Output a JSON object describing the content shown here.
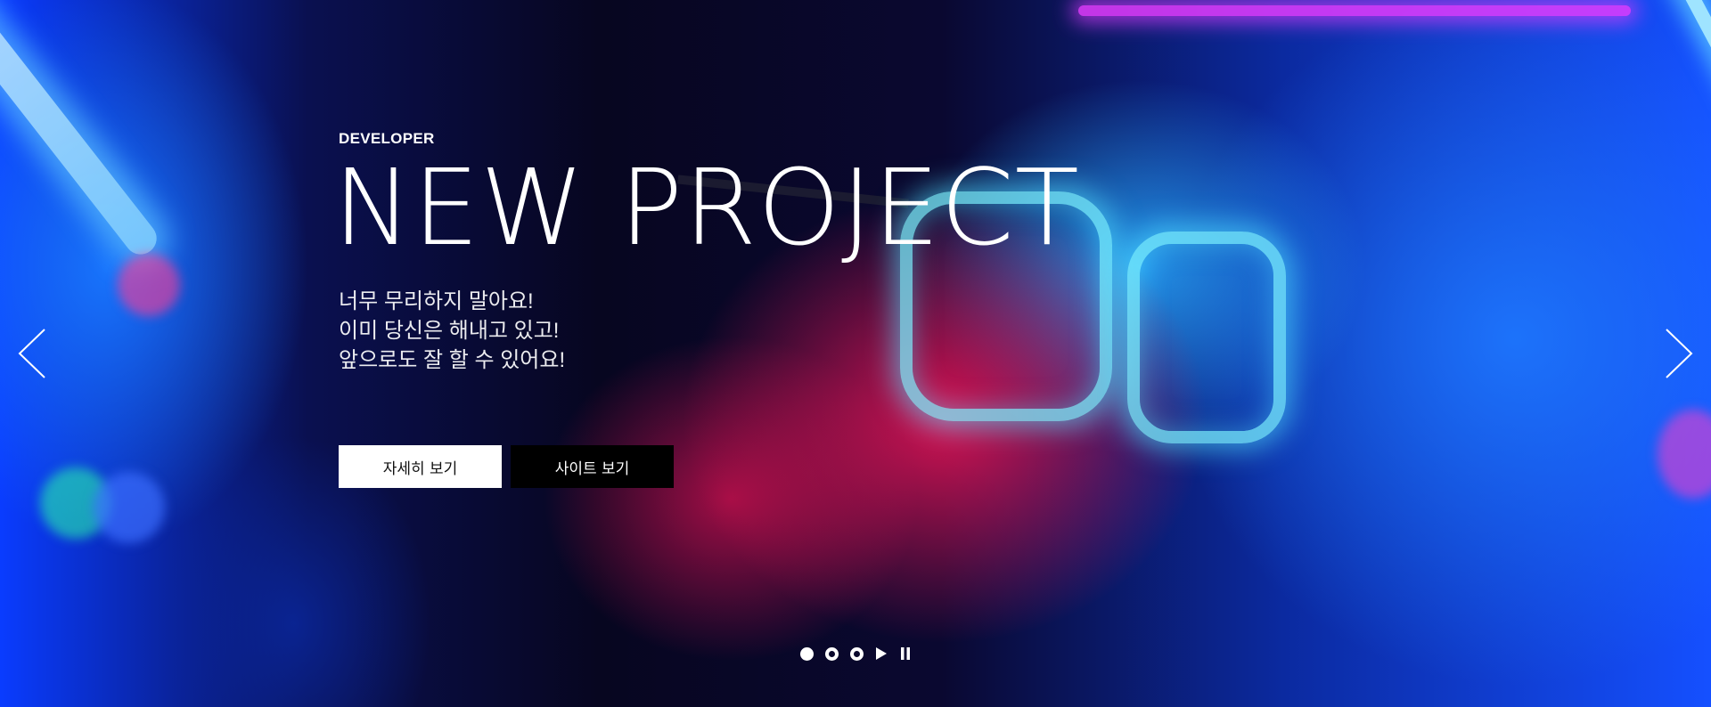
{
  "hero": {
    "eyebrow": "DEVELOPER",
    "title": "NEW PROJECT",
    "description_lines": [
      "너무 무리하지 말아요!",
      "이미 당신은 해내고 있고!",
      "앞으로도 잘 할 수 있어요!"
    ],
    "buttons": {
      "detail_label": "자세히 보기",
      "site_label": "사이트 보기"
    }
  },
  "slider": {
    "prev_icon": "chevron-left-icon",
    "next_icon": "chevron-right-icon",
    "slide_count": 3,
    "active_slide": 1,
    "controls": [
      "play-icon",
      "pause-icon"
    ]
  },
  "colors": {
    "accent_magenta": "#e11455",
    "accent_blue": "#1e78ff",
    "text": "#ffffff",
    "button_light_bg": "#ffffff",
    "button_dark_bg": "#000000"
  }
}
